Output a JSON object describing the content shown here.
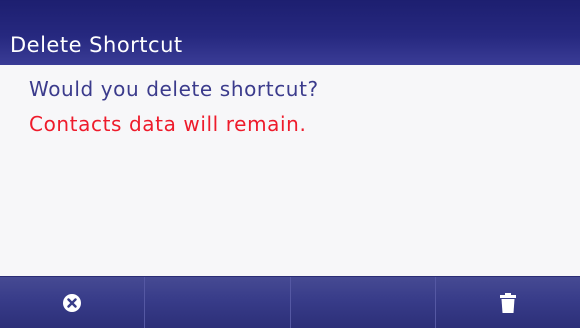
{
  "dialog": {
    "title": "Delete Shortcut",
    "message": "Would you delete shortcut?",
    "warning": "Contacts data will remain."
  },
  "softkeys": {
    "key1_icon": "cancel-icon",
    "key2_icon": "",
    "key3_icon": "",
    "key4_icon": "trash-icon"
  },
  "colors": {
    "title_bar": "#26287f",
    "message_text": "#3b3b8c",
    "warning_text": "#ee1b2b",
    "softkey_bar": "#383c89"
  }
}
